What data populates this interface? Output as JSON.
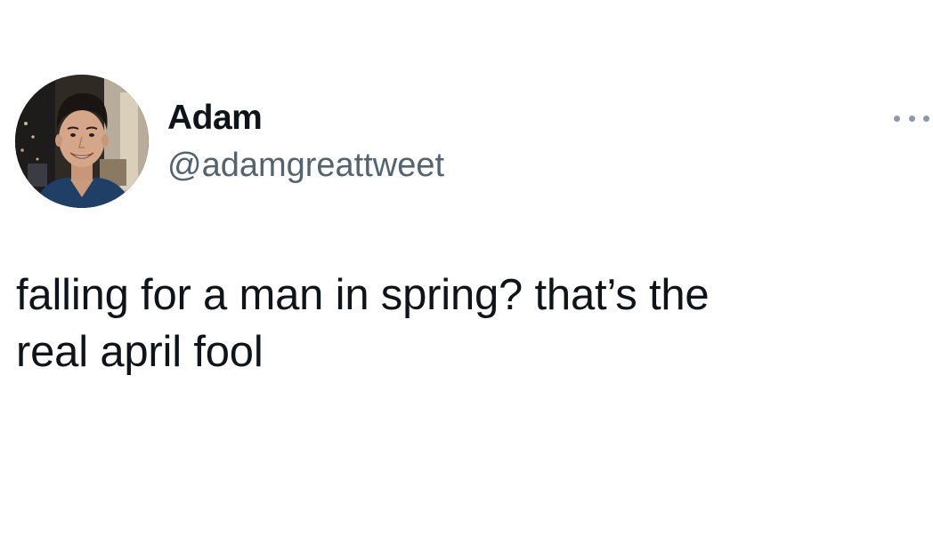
{
  "author": {
    "display_name": "Adam",
    "handle": "@adamgreattweet",
    "avatar_icon": "profile-photo",
    "more_icon": "more-horizontal-icon"
  },
  "tweet": {
    "text": "falling for a man in spring? that’s the\nreal april fool"
  },
  "colors": {
    "text_primary": "#0f1419",
    "text_secondary": "#536471",
    "icon_muted": "#8b98a5",
    "background": "#ffffff"
  }
}
